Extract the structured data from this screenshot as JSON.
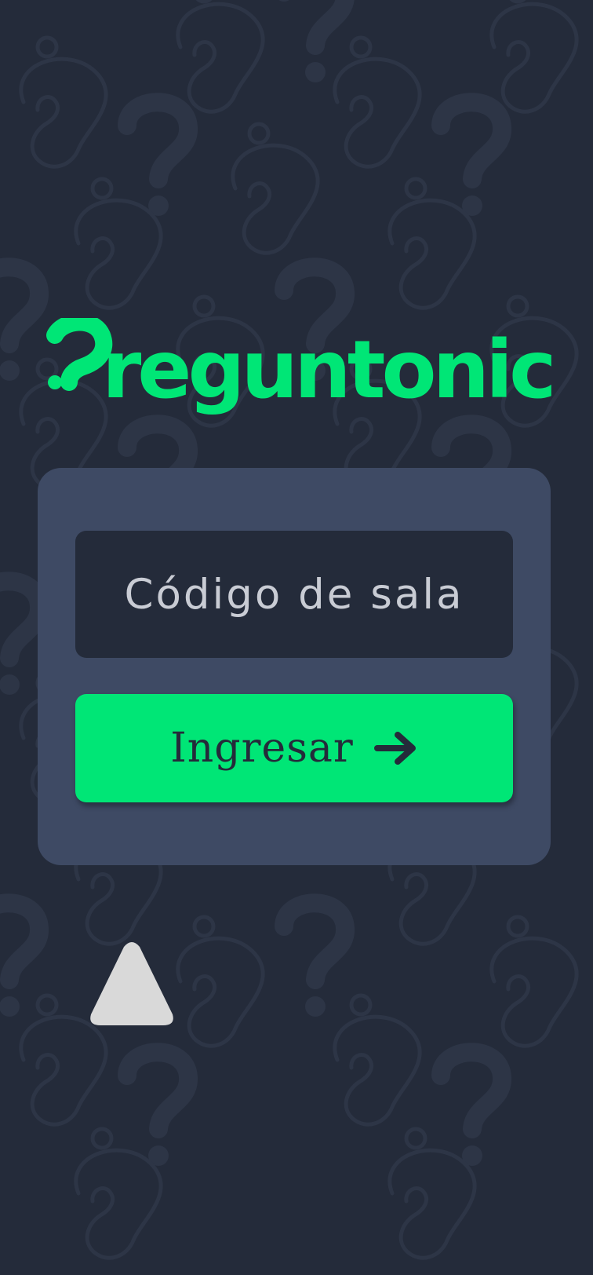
{
  "app": {
    "logo_text": "reguntonic",
    "logo_mark": "question-mark-icon"
  },
  "join_form": {
    "room_code_placeholder": "Código de sala",
    "room_code_value": "",
    "enter_label": "Ingresar",
    "enter_icon": "arrow-right-icon"
  },
  "floating_control": {
    "icon": "triangle-up-icon"
  },
  "colors": {
    "background": "#242b3a",
    "card": "#3e4a64",
    "input_background": "#242b3a",
    "accent": "#00e676",
    "placeholder_text": "#c9ccd4",
    "triangle": "#d9d9d9",
    "pattern": "#2d3546"
  }
}
